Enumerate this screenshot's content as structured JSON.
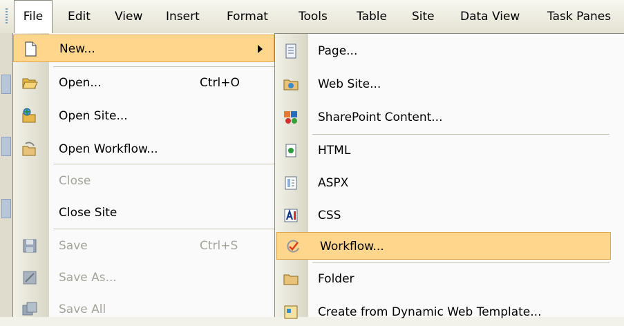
{
  "menubar": {
    "items": [
      {
        "label": "File"
      },
      {
        "label": "Edit"
      },
      {
        "label": "View"
      },
      {
        "label": "Insert"
      },
      {
        "label": "Format"
      },
      {
        "label": "Tools"
      },
      {
        "label": "Table"
      },
      {
        "label": "Site"
      },
      {
        "label": "Data View"
      },
      {
        "label": "Task Panes"
      }
    ]
  },
  "file_menu": {
    "new": {
      "label": "New..."
    },
    "open": {
      "label": "Open...",
      "shortcut": "Ctrl+O"
    },
    "open_site": {
      "label": "Open Site..."
    },
    "open_workflow": {
      "label": "Open Workflow..."
    },
    "close": {
      "label": "Close"
    },
    "close_site": {
      "label": "Close Site"
    },
    "save": {
      "label": "Save",
      "shortcut": "Ctrl+S"
    },
    "save_as": {
      "label": "Save As..."
    },
    "save_all": {
      "label": "Save All"
    }
  },
  "new_submenu": {
    "page": {
      "label": "Page..."
    },
    "web_site": {
      "label": "Web Site..."
    },
    "sharepoint_content": {
      "label": "SharePoint Content..."
    },
    "html": {
      "label": "HTML"
    },
    "aspx": {
      "label": "ASPX"
    },
    "css": {
      "label": "CSS"
    },
    "workflow": {
      "label": "Workflow..."
    },
    "folder": {
      "label": "Folder"
    },
    "dwt": {
      "label": "Create from Dynamic Web Template..."
    }
  },
  "colors": {
    "highlight": "#ffd68c",
    "highlight_border": "#e2a64a"
  }
}
